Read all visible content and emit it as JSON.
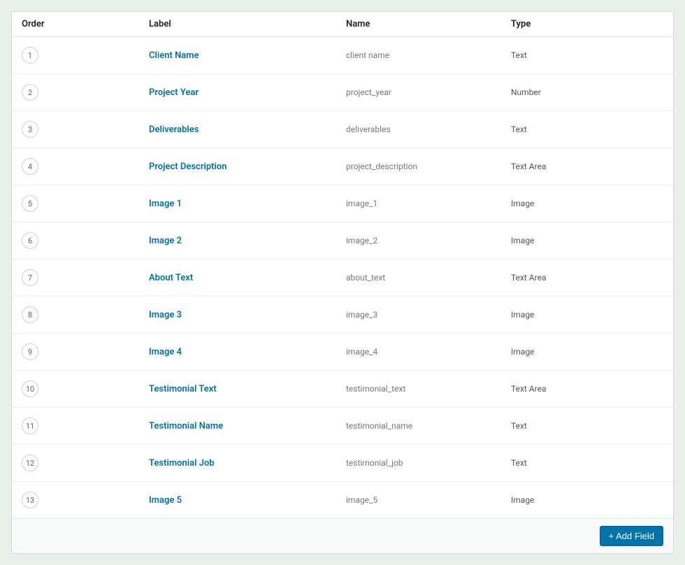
{
  "columns": {
    "order": "Order",
    "label": "Label",
    "name": "Name",
    "type": "Type"
  },
  "fields": [
    {
      "order": "1",
      "label": "Client Name",
      "name": "client name",
      "type": "Text"
    },
    {
      "order": "2",
      "label": "Project Year",
      "name": "project_year",
      "type": "Number"
    },
    {
      "order": "3",
      "label": "Deliverables",
      "name": "deliverables",
      "type": "Text"
    },
    {
      "order": "4",
      "label": "Project Description",
      "name": "project_description",
      "type": "Text Area"
    },
    {
      "order": "5",
      "label": "Image 1",
      "name": "image_1",
      "type": "Image"
    },
    {
      "order": "6",
      "label": "Image 2",
      "name": "image_2",
      "type": "Image"
    },
    {
      "order": "7",
      "label": "About Text",
      "name": "about_text",
      "type": "Text Area"
    },
    {
      "order": "8",
      "label": "Image 3",
      "name": "image_3",
      "type": "Image"
    },
    {
      "order": "9",
      "label": "Image 4",
      "name": "image_4",
      "type": "Image"
    },
    {
      "order": "10",
      "label": "Testimonial Text",
      "name": "testimonial_text",
      "type": "Text Area"
    },
    {
      "order": "11",
      "label": "Testimonial Name",
      "name": "testimonial_name",
      "type": "Text"
    },
    {
      "order": "12",
      "label": "Testimonial Job",
      "name": "testimonial_job",
      "type": "Text"
    },
    {
      "order": "13",
      "label": "Image 5",
      "name": "image_5",
      "type": "Image"
    }
  ],
  "footer": {
    "add_field_label": "+ Add Field"
  }
}
